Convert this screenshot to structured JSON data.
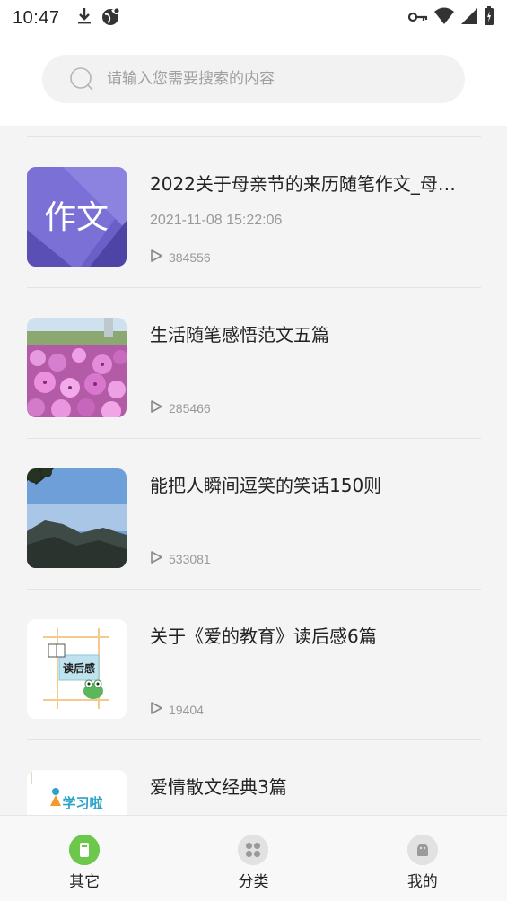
{
  "status_bar": {
    "time": "10:47"
  },
  "search": {
    "placeholder": "请输入您需要搜索的内容"
  },
  "items": [
    {
      "title": "2022关于母亲节的来历随笔作文_母…",
      "date": "2021-11-08 15:22:06",
      "views": "384556",
      "thumb_text": "作文"
    },
    {
      "title": "生活随笔感悟范文五篇",
      "date": "",
      "views": "285466"
    },
    {
      "title": "能把人瞬间逗笑的笑话150则",
      "date": "",
      "views": "533081"
    },
    {
      "title": "关于《爱的教育》读后感6篇",
      "date": "",
      "views": "19404",
      "thumb_text": "读后感"
    },
    {
      "title": "爱情散文经典3篇",
      "date": "",
      "views": "",
      "thumb_text": "学习啦"
    }
  ],
  "nav": {
    "items": [
      {
        "label": "其它",
        "icon": "other-icon",
        "active": true
      },
      {
        "label": "分类",
        "icon": "category-icon",
        "active": false
      },
      {
        "label": "我的",
        "icon": "profile-icon",
        "active": false
      }
    ]
  },
  "colors": {
    "accent": "#6cc84a",
    "nav_icon_inactive": "#dcdcdc"
  }
}
